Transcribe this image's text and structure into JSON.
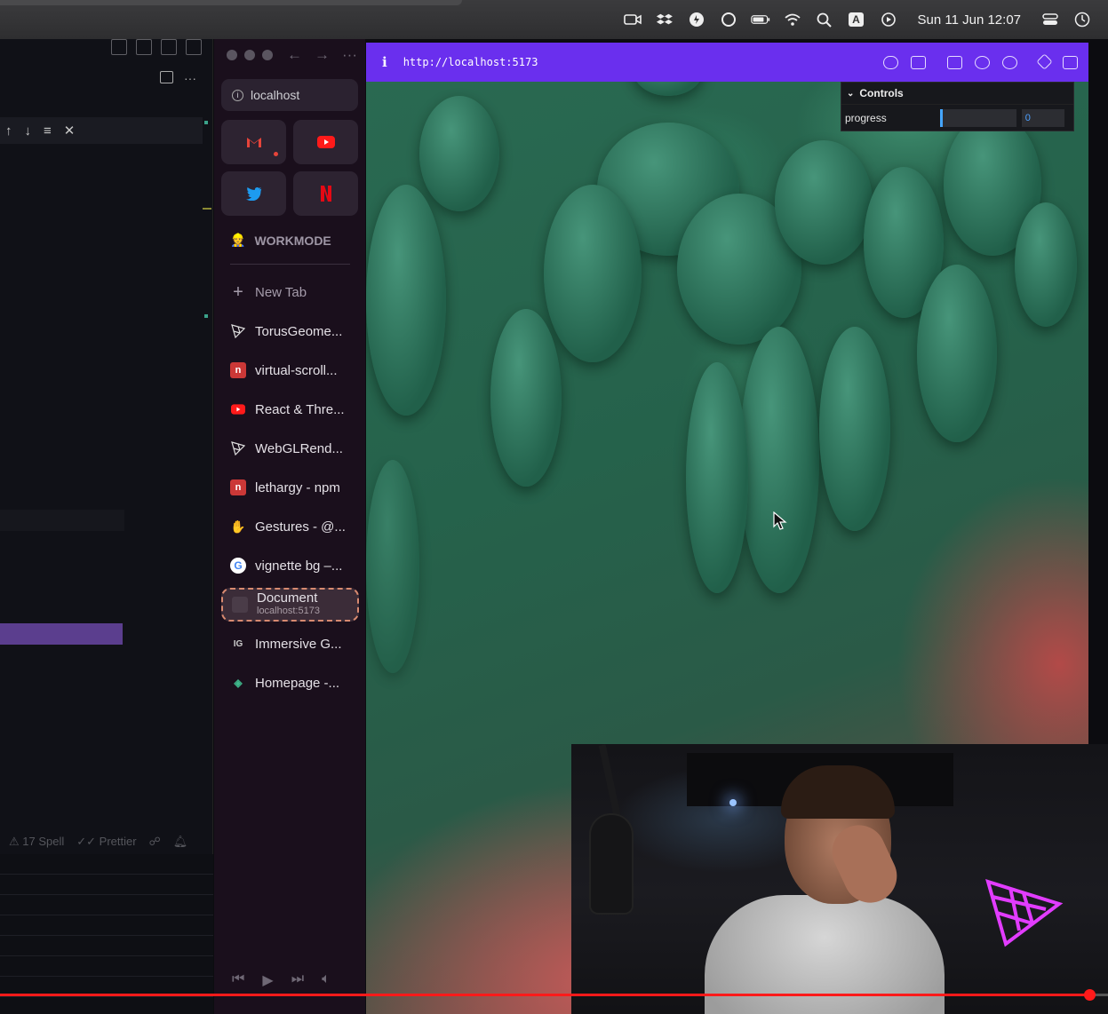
{
  "menubar": {
    "clock": "Sun 11 Jun  12:07",
    "icons": [
      "camera-icon",
      "dropbox-icon",
      "battery-app-icon",
      "circle-icon",
      "battery-icon",
      "wifi-icon",
      "search-icon",
      "input-source-icon",
      "play-circle-icon",
      "control-center-icon",
      "clock-icon"
    ],
    "input_source_label": "A"
  },
  "editor": {
    "find_widget_icons": [
      "arrow-up-icon",
      "arrow-down-icon",
      "lines-icon",
      "close-icon"
    ],
    "status": {
      "spell": "17 Spell",
      "prettier": "Prettier"
    }
  },
  "sidebar": {
    "url": "localhost",
    "favorites": [
      {
        "name": "Gmail",
        "icon": "gmail-icon",
        "color": "#e6443a"
      },
      {
        "name": "YouTube",
        "icon": "youtube-icon",
        "color": "#ff0000"
      },
      {
        "name": "Twitter",
        "icon": "twitter-icon",
        "color": "#1d9bf0"
      },
      {
        "name": "Netflix",
        "icon": "netflix-icon",
        "color": "#e50914"
      }
    ],
    "space": {
      "emoji": "👷",
      "label": "WORKMODE"
    },
    "new_tab": "New Tab",
    "tabs": [
      {
        "label": "TorusGeome...",
        "icon": "threejs-icon"
      },
      {
        "label": "virtual-scroll...",
        "icon": "npm-icon"
      },
      {
        "label": "React & Thre...",
        "icon": "youtube-icon"
      },
      {
        "label": "WebGLRend...",
        "icon": "threejs-icon"
      },
      {
        "label": "lethargy - npm",
        "icon": "npm-icon"
      },
      {
        "label": "Gestures - @...",
        "icon": "hand-icon"
      },
      {
        "label": "vignette bg –...",
        "icon": "google-icon"
      }
    ],
    "active_tab": {
      "title": "Document",
      "subtitle": "localhost:5173"
    },
    "tabs_after": [
      {
        "label": "Immersive G...",
        "icon": "ig-icon",
        "badge": "IG"
      },
      {
        "label": "Homepage -...",
        "icon": "diamond-icon"
      }
    ]
  },
  "browser": {
    "url": "http://localhost:5173",
    "devbar_icons": [
      "link-icon",
      "camera-icon",
      "terminal-icon",
      "globe-icon",
      "crosshair-icon",
      "code-icon",
      "split-view-icon"
    ]
  },
  "controls": {
    "title": "Controls",
    "param_label": "progress",
    "param_value": "0"
  },
  "video": {
    "progress_fraction": 0.983,
    "colors": {
      "bar": "#ff1a1a",
      "accent": "#6a2fee"
    }
  }
}
